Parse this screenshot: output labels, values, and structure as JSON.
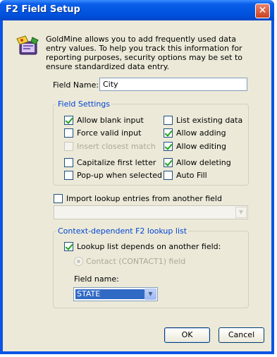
{
  "window": {
    "title": "F2 Field Setup",
    "close_glyph": "✕"
  },
  "intro": {
    "text": "GoldMine allows you to add frequently used data entry values.  To help you track this information for reporting purposes, security options may be set to ensure standardized data entry."
  },
  "field_name": {
    "label": "Field Name:",
    "value": "City"
  },
  "field_settings": {
    "title": "Field Settings",
    "options": {
      "allow_blank": {
        "label": "Allow blank input",
        "checked": true,
        "enabled": true
      },
      "force_valid": {
        "label": "Force valid input",
        "checked": false,
        "enabled": true
      },
      "insert_closest": {
        "label": "Insert closest match",
        "checked": false,
        "enabled": false
      },
      "capitalize_first": {
        "label": "Capitalize first letter",
        "checked": false,
        "enabled": true
      },
      "popup_selected": {
        "label": "Pop-up when selected",
        "checked": false,
        "enabled": true
      },
      "list_existing": {
        "label": "List existing data",
        "checked": false,
        "enabled": true
      },
      "allow_adding": {
        "label": "Allow adding",
        "checked": true,
        "enabled": true
      },
      "allow_editing": {
        "label": "Allow editing",
        "checked": true,
        "enabled": true
      },
      "allow_deleting": {
        "label": "Allow deleting",
        "checked": true,
        "enabled": true
      },
      "auto_fill": {
        "label": "Auto Fill",
        "checked": false,
        "enabled": true
      }
    }
  },
  "import_lookup": {
    "label": "Import lookup entries from another field",
    "checked": false,
    "combo_value": ""
  },
  "context_lookup": {
    "title": "Context-dependent F2 lookup list",
    "depends_label": "Lookup list depends on another field:",
    "depends_checked": true,
    "radio_label": "Contact (CONTACT1) field",
    "field_name_label": "Field name:",
    "field_name_value": "STATE"
  },
  "buttons": {
    "ok": "OK",
    "cancel": "Cancel"
  },
  "icons": {
    "app": "goldmine-icon",
    "dropdown": "chevron-down-icon"
  }
}
